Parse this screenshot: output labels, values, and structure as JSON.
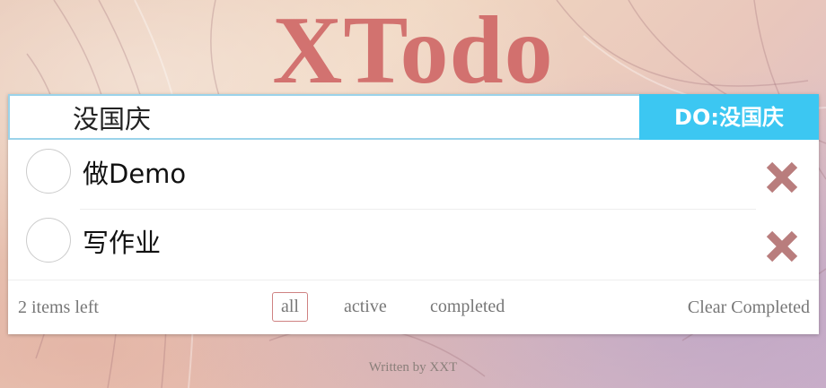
{
  "app": {
    "title": "XTodo"
  },
  "input": {
    "value": "没国庆",
    "placeholder": ""
  },
  "add_button": {
    "label": "DO:没国庆"
  },
  "todos": [
    {
      "label": "做Demo",
      "completed": false
    },
    {
      "label": "写作业",
      "completed": false
    }
  ],
  "footer": {
    "count": "2 items left",
    "filters": [
      "all",
      "active",
      "completed"
    ],
    "selected_filter": "all",
    "clear_label": "Clear Completed"
  },
  "credit": "Written by XXT",
  "colors": {
    "title": "#cd5f5f",
    "accent": "#3cc7f2",
    "destroy": "#b97d7d",
    "filter_border": "#c98b8b"
  },
  "icons": {
    "toggle": "circle-checkbox-icon",
    "destroy": "close-x-icon"
  }
}
